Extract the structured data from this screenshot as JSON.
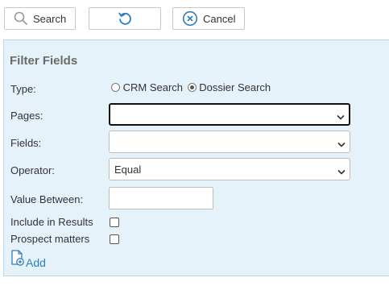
{
  "toolbar": {
    "search_label": "Search",
    "cancel_label": "Cancel"
  },
  "filter": {
    "title": "Filter Fields",
    "type_label": "Type:",
    "type_options": [
      "CRM Search",
      "Dossier Search"
    ],
    "type_selected": "Dossier Search",
    "pages_label": "Pages:",
    "pages_value": "",
    "fields_label": "Fields:",
    "fields_value": "",
    "operator_label": "Operator:",
    "operator_value": "Equal",
    "value_between_label": "Value Between:",
    "value_between_value": "",
    "include_label": "Include in Results",
    "include_checked": false,
    "prospect_label": "Prospect matters",
    "prospect_checked": false,
    "add_label": "Add"
  },
  "colors": {
    "panel_bg": "#e6f2fa",
    "accent": "#2f7dbb"
  }
}
